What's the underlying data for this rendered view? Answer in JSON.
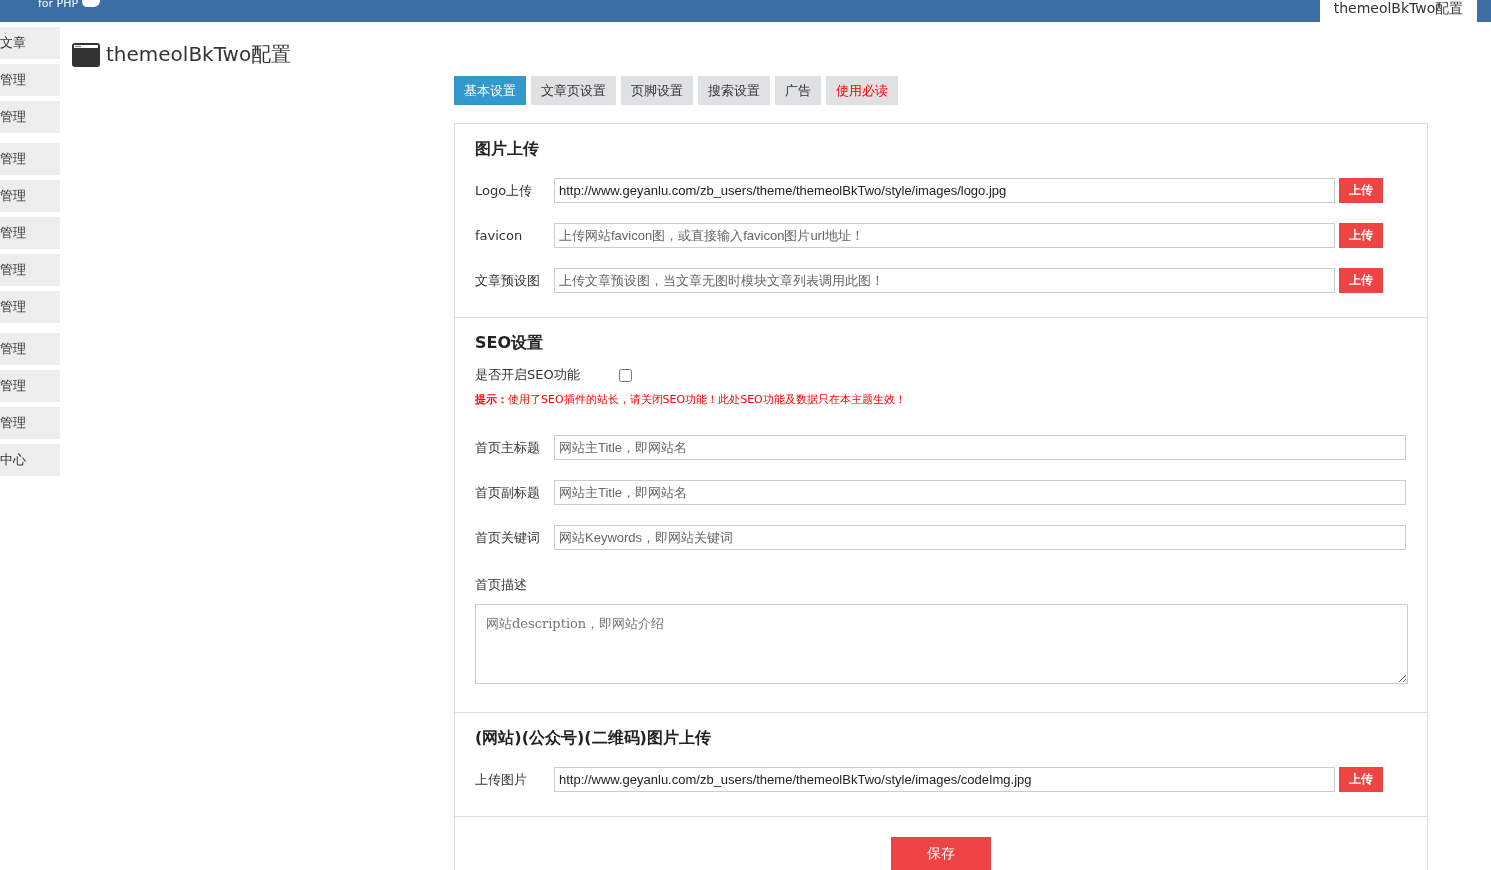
{
  "header": {
    "logo_text": "for PHP",
    "tab": "themeolBkTwo配置"
  },
  "sidebar": {
    "groups": [
      {
        "items": [
          "文章",
          "管理",
          "管理"
        ]
      },
      {
        "items": [
          "管理",
          "管理",
          "管理",
          "管理",
          "管理"
        ]
      },
      {
        "items": [
          "管理",
          "管理",
          "管理",
          "中心"
        ]
      }
    ]
  },
  "page_title": "themeolBkTwo配置",
  "tabs": [
    {
      "label": "基本设置",
      "selected": true,
      "kind": "normal"
    },
    {
      "label": "文章页设置",
      "selected": false,
      "kind": "normal"
    },
    {
      "label": "页脚设置",
      "selected": false,
      "kind": "normal"
    },
    {
      "label": "搜索设置",
      "selected": false,
      "kind": "normal"
    },
    {
      "label": "广告",
      "selected": false,
      "kind": "normal"
    },
    {
      "label": "使用必读",
      "selected": false,
      "kind": "notice"
    }
  ],
  "sections": [
    {
      "title": "图片上传",
      "rows": [
        {
          "kind": "upload",
          "label": "Logo上传",
          "value": "http://www.geyanlu.com/zb_users/theme/themeolBkTwo/style/images/logo.jpg",
          "button": "上传"
        },
        {
          "kind": "upload",
          "label": "favicon",
          "placeholder": "上传网站favicon图，或直接输入favicon图片url地址！",
          "button": "上传"
        },
        {
          "kind": "upload",
          "label": "文章预设图",
          "placeholder": "上传文章预设图，当文章无图时模块文章列表调用此图！",
          "button": "上传"
        }
      ]
    },
    {
      "title": "SEO设置",
      "rows": [
        {
          "kind": "checkbox",
          "label": "是否开启SEO功能",
          "checked": false
        },
        {
          "kind": "hint",
          "text": "**提示：**使用了SEO插件的站长，请关闭SEO功能！此处SEO功能及数据只在本主题生效！"
        },
        {
          "kind": "text",
          "label": "首页主标题",
          "placeholder": "网站主Title，即网站名"
        },
        {
          "kind": "text",
          "label": "首页副标题",
          "placeholder": "网站主Title，即网站名"
        },
        {
          "kind": "text",
          "label": "首页关键词",
          "placeholder": "网站Keywords，即网站关键词"
        },
        {
          "kind": "textarea",
          "label": "首页描述",
          "placeholder": "网站description，即网站介绍"
        }
      ]
    },
    {
      "title": "(网站)(公众号)(二维码)图片上传",
      "rows": [
        {
          "kind": "upload",
          "label": "上传图片",
          "value": "http://www.geyanlu.com/zb_users/theme/themeolBkTwo/style/images/codeImg.jpg",
          "button": "上传"
        }
      ]
    }
  ],
  "save_button": "保存"
}
